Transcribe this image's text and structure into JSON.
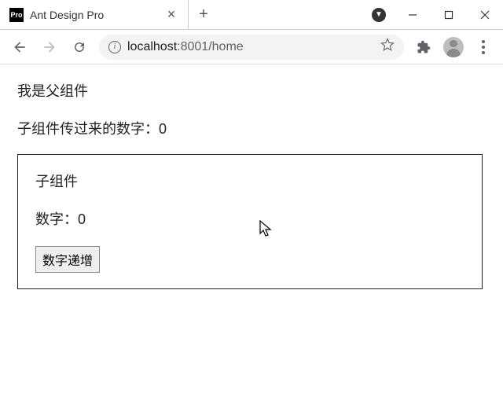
{
  "browser": {
    "tab": {
      "title": "Ant Design Pro",
      "favicon_label": "Pro"
    },
    "url": {
      "host": "localhost",
      "port": ":8001",
      "path": "/home"
    }
  },
  "page": {
    "parent_title": "我是父组件",
    "parent_value_label": "子组件传过来的数字：",
    "parent_value": "0",
    "child": {
      "title": "子组件",
      "value_label": "数字：",
      "value": "0",
      "button_label": "数字递增"
    }
  }
}
